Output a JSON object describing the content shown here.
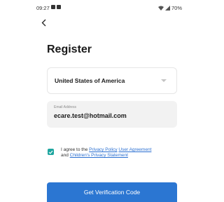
{
  "status_bar": {
    "time": "09:27",
    "battery": "70%",
    "icons": [
      "notification-icon",
      "notification-icon",
      "wifi-icon",
      "signal-icon"
    ]
  },
  "nav": {
    "back_icon": "chevron-left-icon"
  },
  "title": "Register",
  "country": {
    "value": "United States of America",
    "icon": "dropdown-arrow-icon"
  },
  "email": {
    "label": "Email Address",
    "value": "ecare.test@hotmail.com"
  },
  "agreement": {
    "checked": true,
    "prefix": "I agree to the",
    "privacy_policy": "Privacy Policy",
    "user_agreement": "User Agreement",
    "and": "and",
    "children_privacy": "Children's Privacy Statement"
  },
  "button": {
    "label": "Get Verification Code"
  },
  "colors": {
    "accent": "#2b76d2",
    "checkbox": "#1fa6a0",
    "link": "#2a6fd1",
    "field_bg": "#f2f2f2"
  }
}
